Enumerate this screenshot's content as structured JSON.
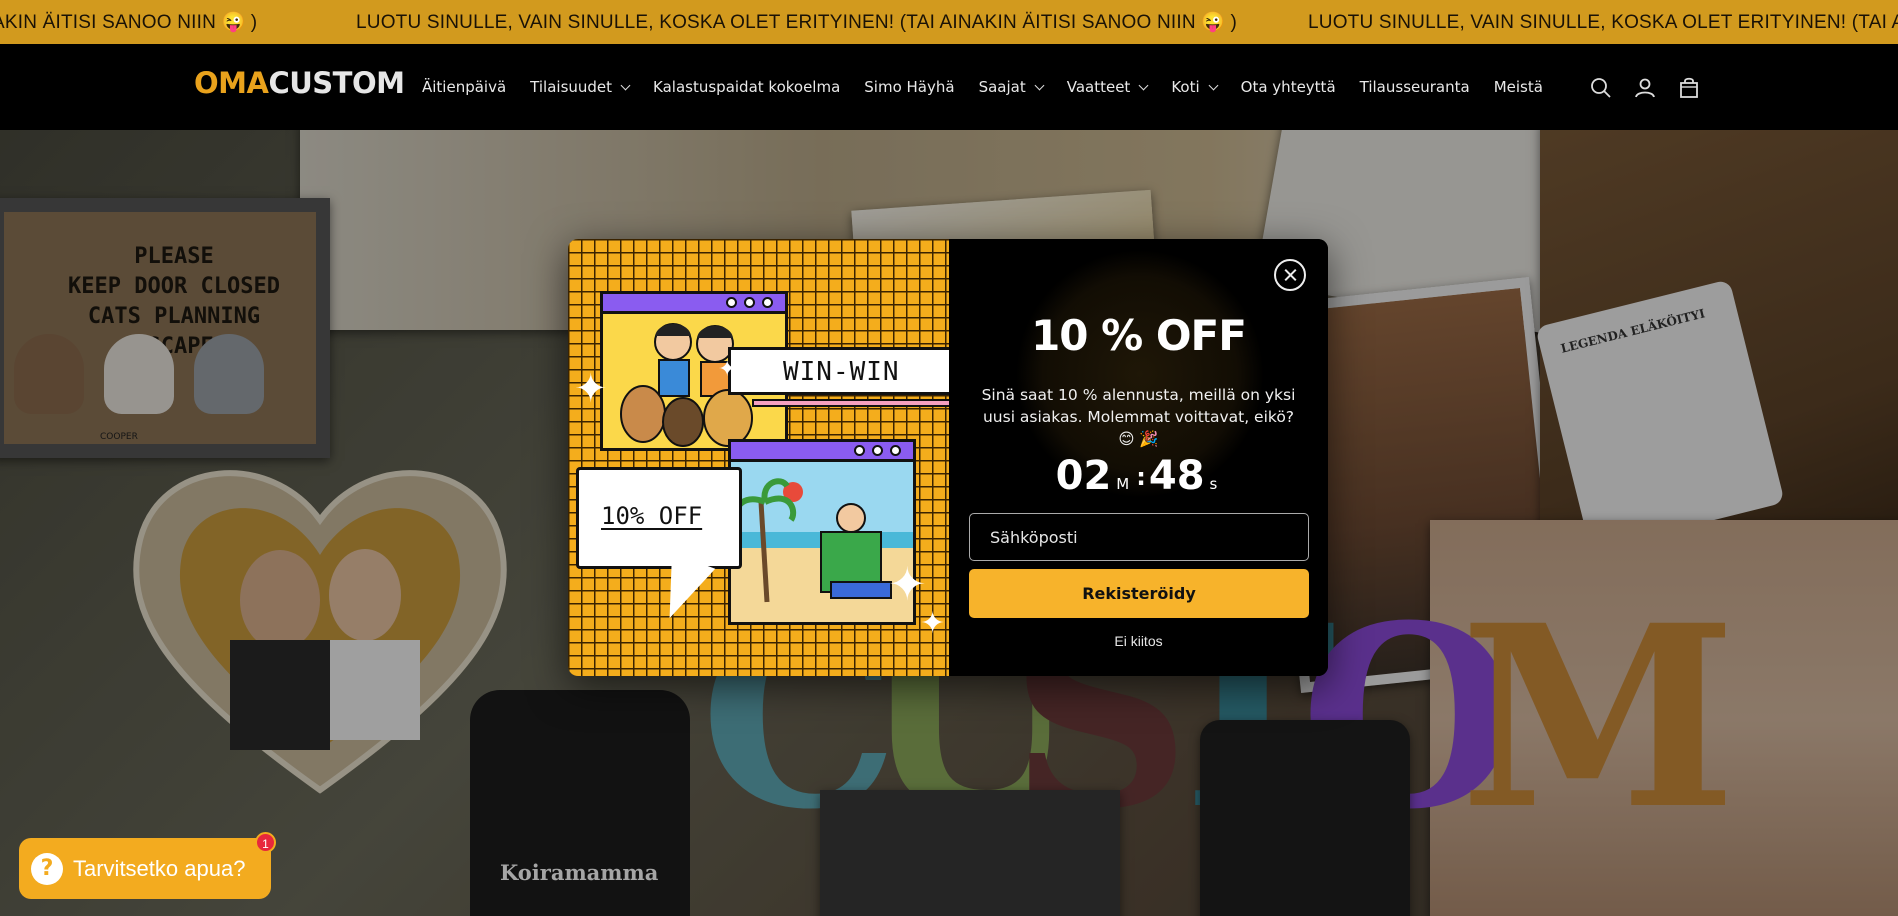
{
  "announcement": {
    "messages": [
      "AKIN ÄITISI SANOO NIIN 😜 )",
      "LUOTU SINULLE, VAIN SINULLE, KOSKA OLET ERITYINEN! (TAI AINAKIN ÄITISI SANOO NIIN 😜 )",
      "LUOTU SINULLE, VAIN SINULLE, KOSKA OLET ERITYINEN! (TAI AINAKIN ÄITISI SANOO NIIN 😜 )"
    ]
  },
  "header": {
    "logo": {
      "part1": "OMA",
      "part2": "CUSTOM"
    },
    "nav": [
      {
        "label": "Äitienpäivä",
        "dropdown": false
      },
      {
        "label": "Tilaisuudet",
        "dropdown": true
      },
      {
        "label": "Kalastuspaidat kokoelma",
        "dropdown": false
      },
      {
        "label": "Simo Häyhä",
        "dropdown": false
      },
      {
        "label": "Saajat",
        "dropdown": true
      },
      {
        "label": "Vaatteet",
        "dropdown": true
      },
      {
        "label": "Koti",
        "dropdown": true
      },
      {
        "label": "Ota yhteyttä",
        "dropdown": false
      },
      {
        "label": "Tilausseuranta",
        "dropdown": false
      },
      {
        "label": "Meistä",
        "dropdown": false
      }
    ],
    "icons": [
      "search-icon",
      "account-icon",
      "cart-icon"
    ]
  },
  "hero": {
    "doormat_text": [
      "PLEASE",
      "KEEP DOOR CLOSED",
      "CATS PLANNING ESCAPE"
    ],
    "doormat_name": "COOPER",
    "big_letters": [
      "C",
      "U",
      "S",
      "T",
      "O",
      "M"
    ],
    "tee_label": "Koiramamma",
    "mug_label": "LEGENDA ELÄKÖITYI"
  },
  "popup": {
    "art": {
      "winwin": "WIN-WIN",
      "bubble": "10% OFF"
    },
    "headline": "10 % OFF",
    "description": "Sinä saat 10 % alennusta, meillä on yksi uusi asiakas. Molemmat voittavat, eikö? 😊 🎉",
    "timer": {
      "minutes": "02",
      "minutes_unit": "M",
      "seconds": "48",
      "seconds_unit": "S"
    },
    "email_placeholder": "Sähköposti",
    "submit_label": "Rekisteröidy",
    "decline_label": "Ei kiitos"
  },
  "help_widget": {
    "label": "Tarvitsetko apua?",
    "badge": "1"
  },
  "colors": {
    "announcement_bg": "#d29a1e",
    "brand_orange": "#e9a21c",
    "button_yellow": "#f7b32b",
    "help_orange": "#f3ab1f",
    "badge_red": "#e8273c"
  }
}
